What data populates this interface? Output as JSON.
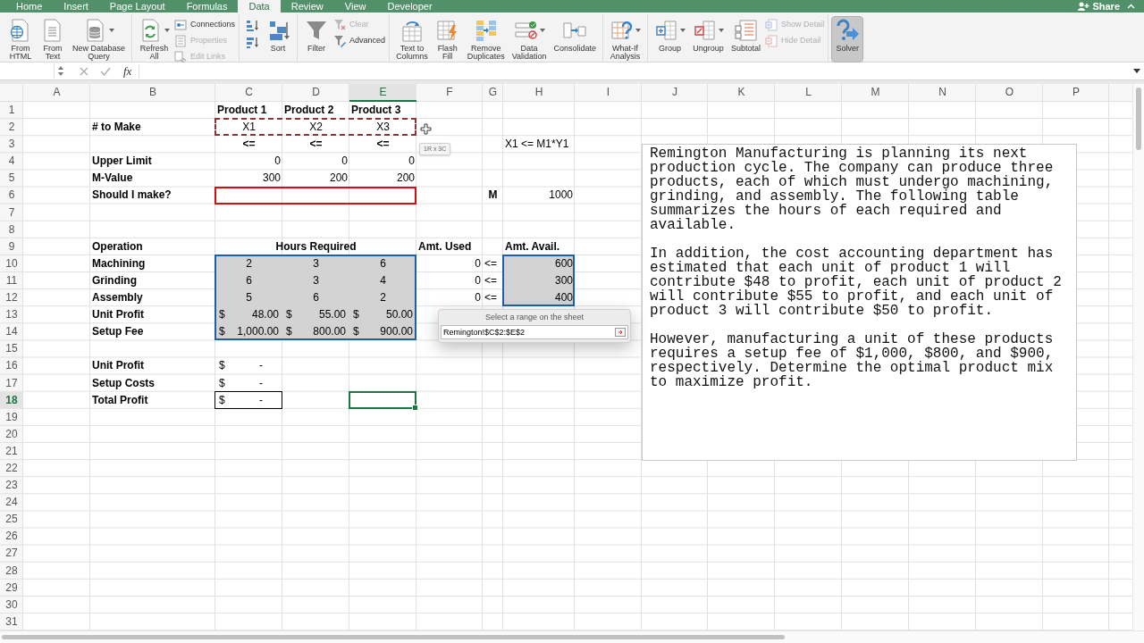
{
  "tabs": [
    {
      "label": "Home",
      "selected": false
    },
    {
      "label": "Insert",
      "selected": false
    },
    {
      "label": "Page Layout",
      "selected": false
    },
    {
      "label": "Formulas",
      "selected": false
    },
    {
      "label": "Data",
      "selected": true
    },
    {
      "label": "Review",
      "selected": false
    },
    {
      "label": "View",
      "selected": false
    },
    {
      "label": "Developer",
      "selected": false
    }
  ],
  "share": {
    "label": "Share"
  },
  "ribbon": {
    "groups": [
      {
        "columns": [
          {
            "kind": "large",
            "label": "From\nHTML",
            "dropdown": false,
            "pressed": false
          },
          {
            "kind": "large",
            "label": "From\nText",
            "dropdown": false,
            "pressed": false
          },
          {
            "kind": "large",
            "label": "New Database\nQuery",
            "dropdown": true,
            "pressed": false
          }
        ]
      },
      {
        "columns": [
          {
            "kind": "large",
            "label": "Refresh\nAll",
            "dropdown": true,
            "pressed": false
          },
          {
            "kind": "stack",
            "items": [
              {
                "kind": "small",
                "label": "Connections",
                "disabled": false
              },
              {
                "kind": "small",
                "label": "Properties",
                "disabled": true
              },
              {
                "kind": "small",
                "label": "Edit Links",
                "disabled": true
              }
            ]
          }
        ]
      },
      {
        "columns": [
          {
            "kind": "stack",
            "items": [
              {
                "kind": "icon",
                "disabled": false
              },
              {
                "kind": "icon",
                "disabled": false
              }
            ]
          },
          {
            "kind": "large",
            "label": "Sort",
            "dropdown": false,
            "pressed": false
          }
        ]
      },
      {
        "columns": [
          {
            "kind": "large",
            "label": "Filter",
            "dropdown": false,
            "pressed": false
          },
          {
            "kind": "stack",
            "items": [
              {
                "kind": "small",
                "label": "Clear",
                "disabled": true
              },
              {
                "kind": "small",
                "label": "Advanced",
                "disabled": false
              }
            ]
          }
        ]
      },
      {
        "columns": [
          {
            "kind": "large",
            "label": "Text to\nColumns",
            "dropdown": false,
            "pressed": false
          },
          {
            "kind": "large",
            "label": "Flash\nFill",
            "dropdown": false,
            "pressed": false
          },
          {
            "kind": "large",
            "label": "Remove\nDuplicates",
            "dropdown": false,
            "pressed": false
          },
          {
            "kind": "large",
            "label": "Data\nValidation",
            "dropdown": true,
            "pressed": false
          },
          {
            "kind": "large",
            "label": "Consolidate",
            "dropdown": false,
            "pressed": false
          }
        ]
      },
      {
        "columns": [
          {
            "kind": "large",
            "label": "What-If\nAnalysis",
            "dropdown": true,
            "pressed": false
          }
        ]
      },
      {
        "columns": [
          {
            "kind": "large",
            "label": "Group",
            "dropdown": true,
            "pressed": false
          },
          {
            "kind": "large",
            "label": "Ungroup",
            "dropdown": true,
            "pressed": false
          },
          {
            "kind": "large",
            "label": "Subtotal",
            "dropdown": false,
            "pressed": false
          },
          {
            "kind": "stack",
            "items": [
              {
                "kind": "small",
                "label": "Show Detail",
                "disabled": true
              },
              {
                "kind": "small",
                "label": "Hide Detail",
                "disabled": true
              }
            ]
          }
        ]
      },
      {
        "columns": [
          {
            "kind": "large",
            "label": "Solver",
            "dropdown": false,
            "pressed": true
          }
        ]
      }
    ]
  },
  "formula_bar": {
    "function_label": "fx"
  },
  "sheet": {
    "columns": [
      {
        "label": "A",
        "selected": false
      },
      {
        "label": "B",
        "selected": false
      },
      {
        "label": "C",
        "selected": false
      },
      {
        "label": "D",
        "selected": false
      },
      {
        "label": "E",
        "selected": true
      },
      {
        "label": "F",
        "selected": false
      },
      {
        "label": "G",
        "selected": false
      },
      {
        "label": "H",
        "selected": false
      },
      {
        "label": "I",
        "selected": false
      },
      {
        "label": "J",
        "selected": false
      },
      {
        "label": "K",
        "selected": false
      },
      {
        "label": "L",
        "selected": false
      },
      {
        "label": "M",
        "selected": false
      },
      {
        "label": "N",
        "selected": false
      },
      {
        "label": "O",
        "selected": false
      },
      {
        "label": "P",
        "selected": false
      }
    ],
    "rows": [
      {
        "label": "1",
        "selected": false,
        "cells": [
          null,
          null,
          {
            "kind": "label",
            "text": "Product 1",
            "shaded": false
          },
          {
            "kind": "label",
            "text": "Product 2",
            "shaded": false
          },
          {
            "kind": "label",
            "text": "Product 3",
            "shaded": false
          }
        ]
      },
      {
        "label": "2",
        "selected": false,
        "cells": [
          null,
          {
            "kind": "label",
            "text": "# to Make",
            "shaded": false
          },
          {
            "kind": "center",
            "text": "X1",
            "shaded": false
          },
          {
            "kind": "center",
            "text": "X2",
            "shaded": false
          },
          {
            "kind": "center",
            "text": "X3",
            "shaded": false
          }
        ]
      },
      {
        "label": "3",
        "selected": false,
        "cells": [
          null,
          null,
          {
            "kind": "header",
            "text": "<=",
            "shaded": false
          },
          {
            "kind": "header",
            "text": "<=",
            "shaded": false
          },
          {
            "kind": "header",
            "text": "<=",
            "shaded": false
          },
          null,
          null,
          {
            "kind": "text",
            "text": "X1 <= M1*Y1",
            "shaded": false
          }
        ]
      },
      {
        "label": "4",
        "selected": false,
        "cells": [
          null,
          {
            "kind": "label",
            "text": "Upper Limit",
            "shaded": false
          },
          {
            "kind": "number",
            "text": "0",
            "shaded": false
          },
          {
            "kind": "number",
            "text": "0",
            "shaded": false
          },
          {
            "kind": "number",
            "text": "0",
            "shaded": false
          }
        ]
      },
      {
        "label": "5",
        "selected": false,
        "cells": [
          null,
          {
            "kind": "label",
            "text": "M-Value",
            "shaded": false
          },
          {
            "kind": "number",
            "text": "300",
            "shaded": false
          },
          {
            "kind": "number",
            "text": "200",
            "shaded": false
          },
          {
            "kind": "number",
            "text": "200",
            "shaded": false
          }
        ]
      },
      {
        "label": "6",
        "selected": false,
        "cells": [
          null,
          {
            "kind": "label",
            "text": "Should I make?",
            "shaded": false
          },
          null,
          null,
          null,
          null,
          {
            "kind": "header",
            "text": "M",
            "shaded": false
          },
          {
            "kind": "number",
            "text": "1000",
            "shaded": false
          }
        ]
      },
      {
        "label": "7",
        "selected": false
      },
      {
        "label": "8",
        "selected": false
      },
      {
        "label": "9",
        "selected": false,
        "cells": [
          null,
          {
            "kind": "label",
            "text": "Operation",
            "shaded": false
          },
          {
            "kind": "merged-header",
            "text": "Hours Required",
            "shaded": false
          },
          null,
          null,
          {
            "kind": "label",
            "text": "Amt. Used",
            "shaded": false
          },
          null,
          {
            "kind": "label",
            "text": "Amt. Avail.",
            "shaded": false
          }
        ]
      },
      {
        "label": "10",
        "selected": false,
        "cells": [
          null,
          {
            "kind": "label",
            "text": "Machining",
            "shaded": false
          },
          {
            "kind": "center",
            "text": "2",
            "shaded": true
          },
          {
            "kind": "center",
            "text": "3",
            "shaded": true
          },
          {
            "kind": "center",
            "text": "6",
            "shaded": true
          },
          {
            "kind": "number",
            "text": "0",
            "shaded": false
          },
          {
            "kind": "text",
            "text": "<=",
            "shaded": false
          },
          {
            "kind": "number",
            "text": "600",
            "shaded": true
          }
        ]
      },
      {
        "label": "11",
        "selected": false,
        "cells": [
          null,
          {
            "kind": "label",
            "text": "Grinding",
            "shaded": false
          },
          {
            "kind": "center",
            "text": "6",
            "shaded": true
          },
          {
            "kind": "center",
            "text": "3",
            "shaded": true
          },
          {
            "kind": "center",
            "text": "4",
            "shaded": true
          },
          {
            "kind": "number",
            "text": "0",
            "shaded": false
          },
          {
            "kind": "text",
            "text": "<=",
            "shaded": false
          },
          {
            "kind": "number",
            "text": "300",
            "shaded": true
          }
        ]
      },
      {
        "label": "12",
        "selected": false,
        "cells": [
          null,
          {
            "kind": "label",
            "text": "Assembly",
            "shaded": false
          },
          {
            "kind": "center",
            "text": "5",
            "shaded": true
          },
          {
            "kind": "center",
            "text": "6",
            "shaded": true
          },
          {
            "kind": "center",
            "text": "2",
            "shaded": true
          },
          {
            "kind": "number",
            "text": "0",
            "shaded": false
          },
          {
            "kind": "text",
            "text": "<=",
            "shaded": false
          },
          {
            "kind": "number",
            "text": "400",
            "shaded": true
          }
        ]
      },
      {
        "label": "13",
        "selected": false,
        "cells": [
          null,
          {
            "kind": "label",
            "text": "Unit Profit",
            "shaded": false
          },
          {
            "kind": "currency",
            "symbol": "$",
            "text": "48.00",
            "shaded": true
          },
          {
            "kind": "currency",
            "symbol": "$",
            "text": "55.00",
            "shaded": true
          },
          {
            "kind": "currency",
            "symbol": "$",
            "text": "50.00",
            "shaded": true
          }
        ]
      },
      {
        "label": "14",
        "selected": false,
        "cells": [
          null,
          {
            "kind": "label",
            "text": "Setup Fee",
            "shaded": false
          },
          {
            "kind": "currency",
            "symbol": "$",
            "text": "1,000.00",
            "shaded": true
          },
          {
            "kind": "currency",
            "symbol": "$",
            "text": "800.00",
            "shaded": true
          },
          {
            "kind": "currency",
            "symbol": "$",
            "text": "900.00",
            "shaded": true
          }
        ]
      },
      {
        "label": "15",
        "selected": false
      },
      {
        "label": "16",
        "selected": false,
        "cells": [
          null,
          {
            "kind": "label",
            "text": "Unit Profit",
            "shaded": false
          },
          {
            "kind": "currency-dash",
            "symbol": "$",
            "text": "-",
            "shaded": false
          }
        ]
      },
      {
        "label": "17",
        "selected": false,
        "cells": [
          null,
          {
            "kind": "label",
            "text": "Setup Costs",
            "shaded": false
          },
          {
            "kind": "currency-dash",
            "symbol": "$",
            "text": "-",
            "shaded": false
          }
        ]
      },
      {
        "label": "18",
        "selected": true,
        "cells": [
          null,
          {
            "kind": "label",
            "text": "Total Profit",
            "shaded": false
          },
          {
            "kind": "currency-dash",
            "symbol": "$",
            "text": "-",
            "shaded": false
          }
        ]
      },
      {
        "label": "19",
        "selected": false
      },
      {
        "label": "20",
        "selected": false
      },
      {
        "label": "21",
        "selected": false
      },
      {
        "label": "22",
        "selected": false
      },
      {
        "label": "23",
        "selected": false
      },
      {
        "label": "24",
        "selected": false
      },
      {
        "label": "25",
        "selected": false
      },
      {
        "label": "26",
        "selected": false
      },
      {
        "label": "27",
        "selected": false
      },
      {
        "label": "28",
        "selected": false
      },
      {
        "label": "29",
        "selected": false
      },
      {
        "label": "30",
        "selected": false
      },
      {
        "label": "31",
        "selected": false
      }
    ]
  },
  "size_tooltip": "1R x 3C",
  "text_box": {
    "paragraphs": [
      "Remington Manufacturing is planning its next production cycle. The company can produce three products, each of which must undergo machining, grinding, and assembly. The following table summarizes the hours of each required and available.",
      "In addition, the cost accounting department has estimated that each unit of product 1 will contribute $48 to profit, each unit of product 2 will contribute $55 to profit, and each unit of product 3 will contribute $50 to profit.",
      "However, manufacturing a unit of these products requires a setup fee of $1,000, $800, and $900, respectively. Determine the optimal product mix to maximize profit."
    ]
  },
  "range_dialog": {
    "title": "Select a range on the sheet",
    "value": "Remington!$C$2:$E$2"
  }
}
